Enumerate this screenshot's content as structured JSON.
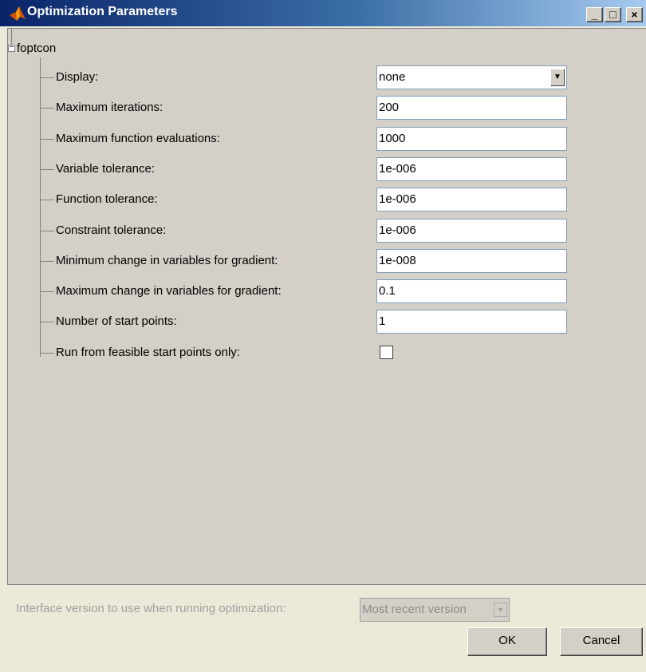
{
  "window": {
    "title": "Optimization Parameters",
    "minimize_glyph": "_",
    "maximize_glyph": "□",
    "close_glyph": "×",
    "icon": "matlab-logo-icon"
  },
  "tree": {
    "root_label": "foptcon",
    "expand_glyph": "−",
    "params": [
      {
        "label": "Display:",
        "type": "select",
        "value": "none"
      },
      {
        "label": "Maximum iterations:",
        "type": "text",
        "value": "200"
      },
      {
        "label": "Maximum function evaluations:",
        "type": "text",
        "value": "1000"
      },
      {
        "label": "Variable tolerance:",
        "type": "text",
        "value": "1e-006"
      },
      {
        "label": "Function tolerance:",
        "type": "text",
        "value": "1e-006"
      },
      {
        "label": "Constraint tolerance:",
        "type": "text",
        "value": "1e-006"
      },
      {
        "label": "Minimum change in variables for gradient:",
        "type": "text",
        "value": "1e-008"
      },
      {
        "label": "Maximum change in variables for gradient:",
        "type": "text",
        "value": "0.1"
      },
      {
        "label": "Number of start points:",
        "type": "text",
        "value": "1"
      },
      {
        "label": "Run from feasible start points only:",
        "type": "checkbox",
        "checked": false
      }
    ]
  },
  "interface": {
    "label": "Interface version to use when running optimization:",
    "value": "Most recent version",
    "enabled": false
  },
  "buttons": {
    "ok": "OK",
    "cancel": "Cancel"
  },
  "colors": {
    "title_start": "#0a246a",
    "title_end": "#a6caf0",
    "panel": "#d4d0c8"
  }
}
